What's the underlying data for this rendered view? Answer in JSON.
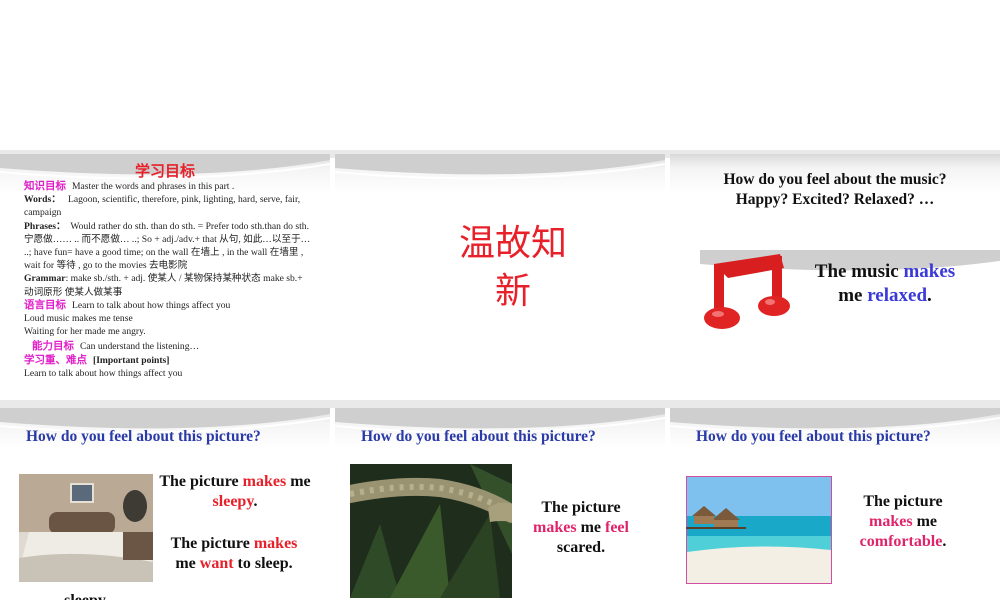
{
  "slide1": {
    "title": "学习目标",
    "knowledge_label": "知识目标",
    "knowledge_text": "Master the words and phrases in this part .",
    "words_label": "Words：",
    "words_text": "Lagoon, scientific, therefore, pink, lighting, hard, serve, fair, campaign",
    "phrases_label": "Phrases：",
    "phrases_text": "Would rather do sth. than do sth. =  Prefer todo sth.than do sth.  宁愿做…… .. 而不愿做… ..;  So + adj./adv.+ that 从句, 如此…以至于… ..; have fun= have a good time;  on the wall 在墙上   , in the wall 在墙里 , wait for 等待 , go to the movies 去电影院",
    "grammar_label": "Grammar",
    "grammar_text": ": make sb./sth. +  adj.  使某人 / 某物保持某种状态  make sb.+ 动词原形  使某人做某事",
    "language_label": "语言目标",
    "language_text": "Learn to talk about how things affect you",
    "language_ex1": "Loud music makes me tense",
    "language_ex2": "Waiting for her made me angry.",
    "ability_label": "能力目标",
    "ability_text": "Can understand the listening…",
    "key_label": "学习重、难点",
    "key_text": "[Important points]",
    "key_desc": "Learn to talk about how things affect you"
  },
  "slide2": {
    "line1": "温故知",
    "line2": "新"
  },
  "slide3": {
    "question1": "How do you feel about the music?",
    "question2": "Happy? Excited? Relaxed? …",
    "ans_a": "The music ",
    "ans_b": "makes",
    "ans_c": "me ",
    "ans_d": "relaxed",
    "ans_e": ".",
    "icon": "music-note-icon"
  },
  "slide4": {
    "question": "How do you feel about this picture?",
    "c1a": "The picture ",
    "c1b": "makes",
    "c1c": " me",
    "c1d": "sleepy",
    "c1e": ".",
    "c2a": "The picture ",
    "c2b": "makes",
    "c2c": "me ",
    "c2d": "want",
    "c2e": " to sleep.",
    "bottom": "sleepy"
  },
  "slide5": {
    "question": "How do you feel about this picture?",
    "c1": "The picture",
    "c2": "makes",
    "c3": " me ",
    "c4": "feel",
    "c5": "scared."
  },
  "slide6": {
    "question": "How do you feel about this picture?",
    "c1": "The picture",
    "c2": "makes",
    "c3": " me",
    "c4": "comfortable",
    "c5": "."
  },
  "colors": {
    "red": "#e8202a",
    "magenta": "#e020c8",
    "blue": "#3a3ad8",
    "navy": "#2a3aa8",
    "pink": "#e0246a"
  }
}
